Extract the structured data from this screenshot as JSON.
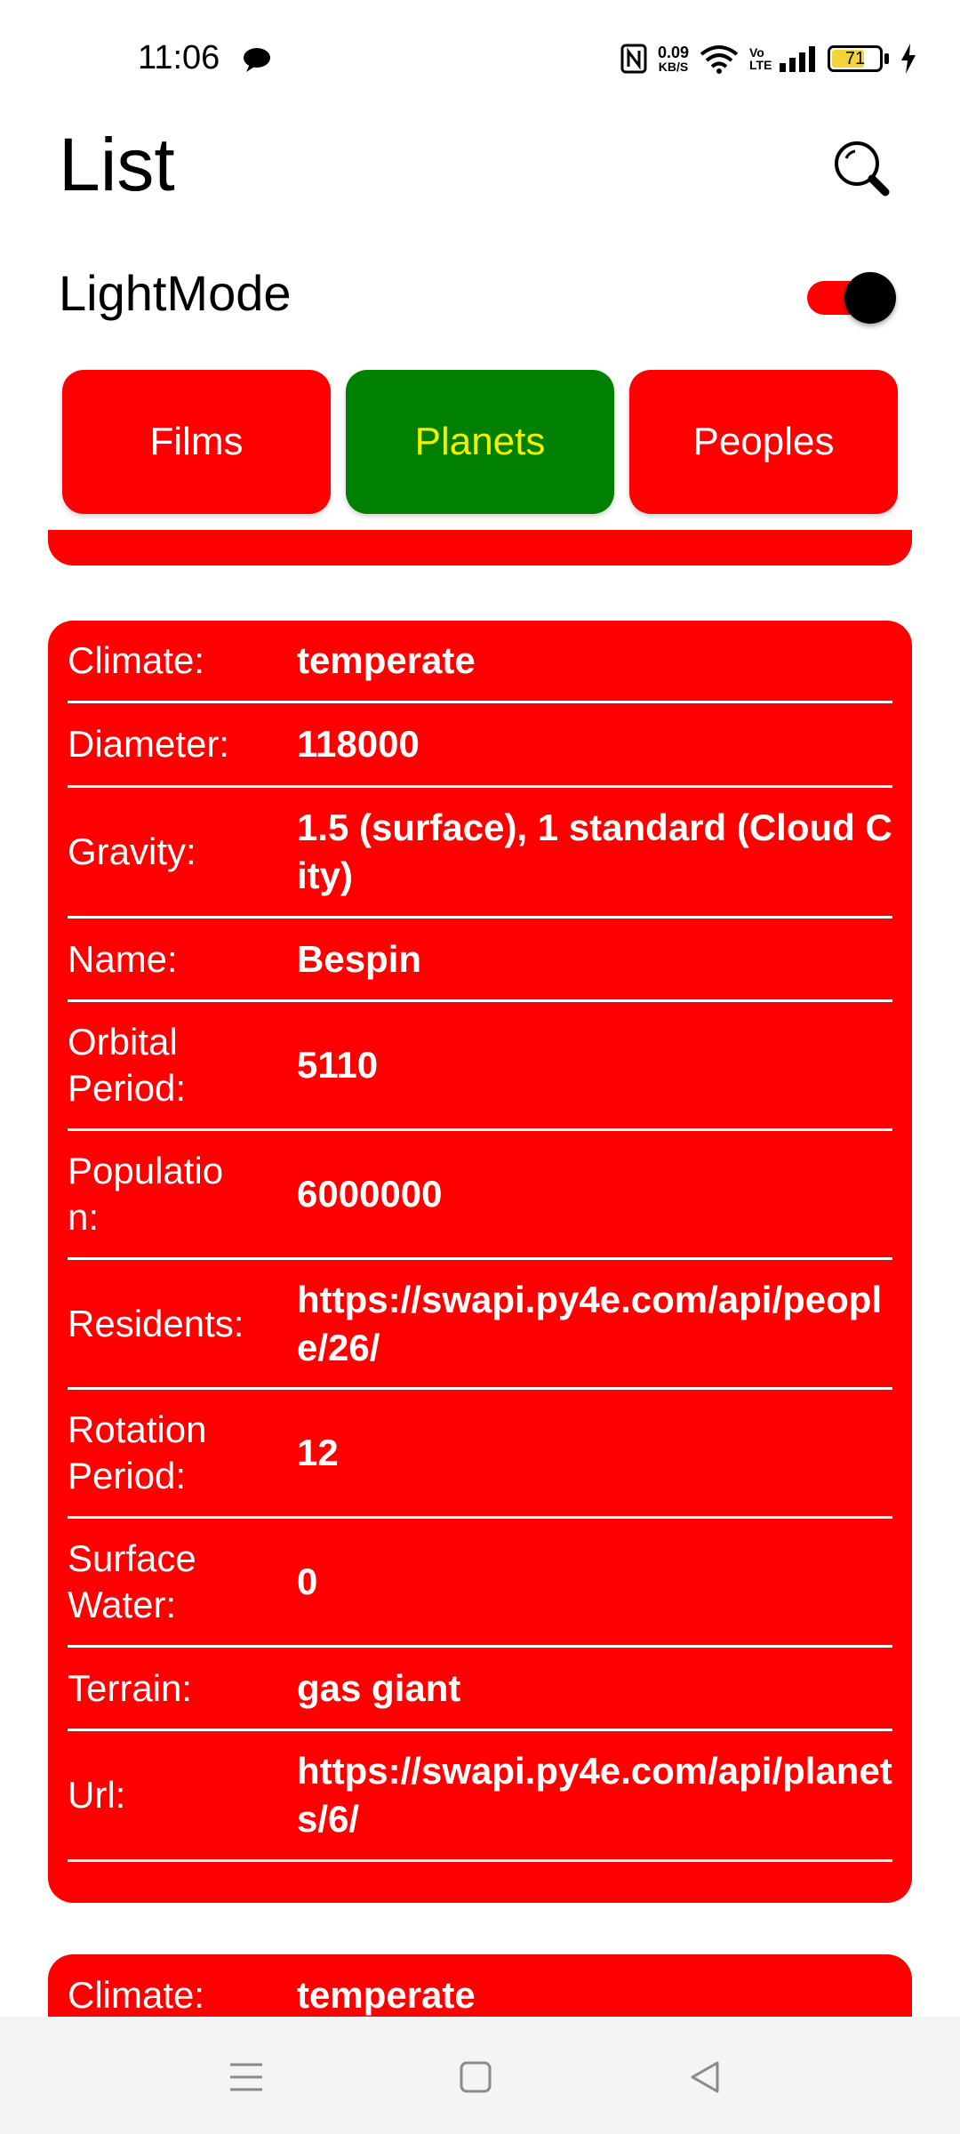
{
  "status_bar": {
    "time": "11:06",
    "net_speed_value": "0.09",
    "net_speed_unit": "KB/S",
    "volte": "Vo LTE",
    "battery_percent": "71",
    "battery_level": 0.71
  },
  "header": {
    "title": "List",
    "search_icon": "search-icon"
  },
  "mode": {
    "label": "LightMode",
    "toggle_on": true
  },
  "tabs": [
    {
      "label": "Films",
      "active": false
    },
    {
      "label": "Planets",
      "active": true
    },
    {
      "label": "Peoples",
      "active": false
    }
  ],
  "colors": {
    "card": "#ff0000",
    "tab": "#ff0000",
    "tab_active": "#008000",
    "tab_active_text": "#f0f000",
    "toggle_track": "#ff0000"
  },
  "planet": {
    "climate_label": "Climate:",
    "climate": "temperate",
    "diameter_label": "Diameter:",
    "diameter": "118000",
    "gravity_label": "Gravity:",
    "gravity": "1.5 (surface), 1 standard (Cloud City)",
    "name_label": "Name:",
    "name": "Bespin",
    "orbital_label": "Orbital Period:",
    "orbital": "5110",
    "population_label": "Population:",
    "population": "6000000",
    "residents_label": "Residents:",
    "residents": "https://swapi.py4e.com/api/people/26/",
    "rotation_label": "Rotation Period:",
    "rotation": "12",
    "surface_label": "Surface Water:",
    "surface": "0",
    "terrain_label": "Terrain:",
    "terrain": "gas giant",
    "url_label": "Url:",
    "url": "https://swapi.py4e.com/api/planets/6/"
  },
  "next_planet": {
    "climate_label": "Climate:",
    "climate": "temperate"
  },
  "nav": {
    "menu_icon": "menu-icon",
    "home_icon": "home-icon",
    "back_icon": "back-icon"
  }
}
